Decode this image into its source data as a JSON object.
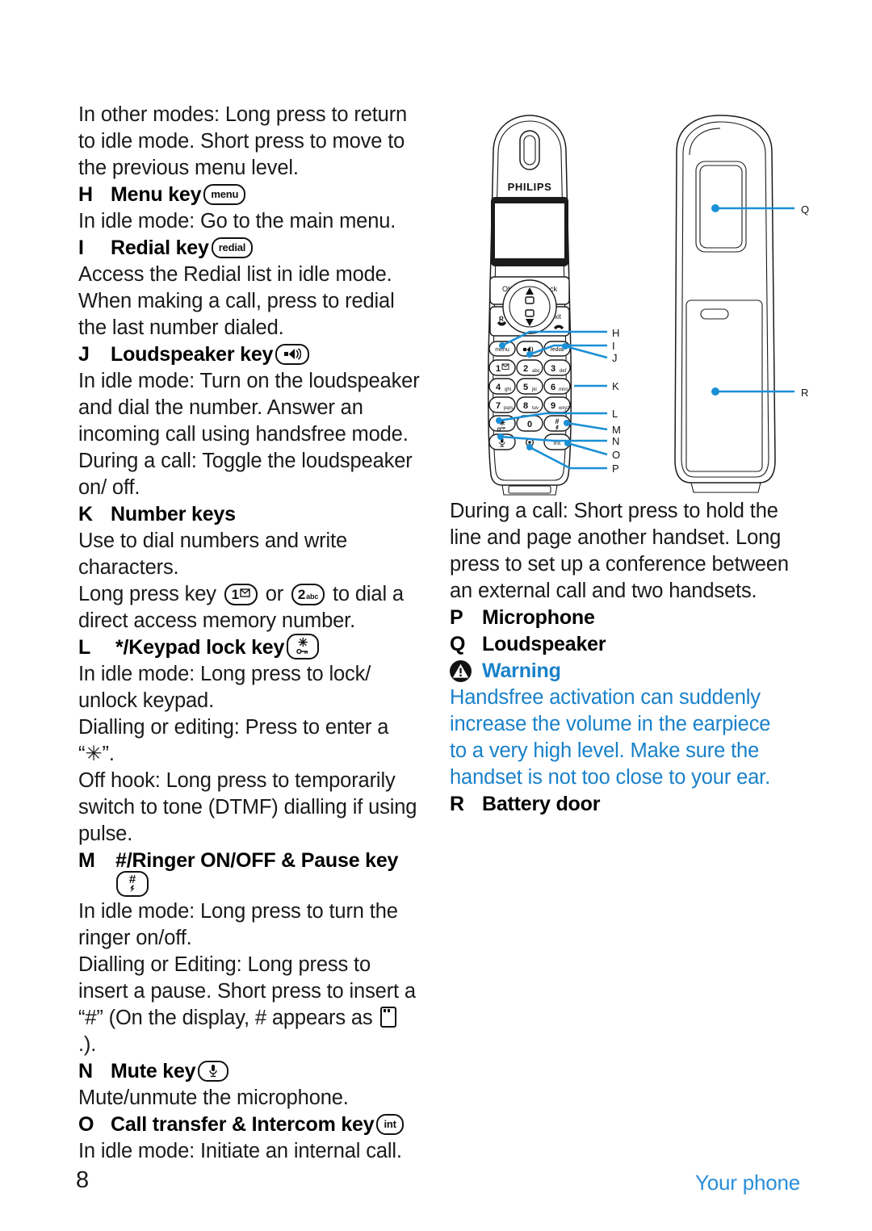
{
  "page": {
    "number": "8",
    "section": "Your phone",
    "accent_blue": "#1981c9",
    "footer_blue": "#2a8fd8"
  },
  "left_column": {
    "intro_paragraph": "In other modes: Long press to return to idle mode. Short press to move to the previous menu level.",
    "entries": [
      {
        "letter": "H",
        "title": "Menu key",
        "chip": {
          "type": "pill-text",
          "label": "menu",
          "icon_name": "menu-key-icon"
        },
        "body": [
          "In idle mode: Go to the main menu."
        ]
      },
      {
        "letter": "I",
        "title": "Redial key",
        "chip": {
          "type": "pill-text",
          "label": "redial",
          "icon_name": "redial-key-icon"
        },
        "body": [
          "Access the Redial list in idle mode.",
          "When making a call, press to redial the last number dialed."
        ]
      },
      {
        "letter": "J",
        "title": "Loudspeaker key",
        "chip": {
          "type": "pill-icon",
          "label": "",
          "icon_name": "loudspeaker-key-icon"
        },
        "body": [
          "In idle mode: Turn on the loudspeaker and dial the number. Answer an incoming call using handsfree mode.",
          "During a call: Toggle the loudspeaker on/ off."
        ]
      },
      {
        "letter": "K",
        "title": "Number keys",
        "chip": null,
        "body": [
          "Use to dial numbers and write characters."
        ],
        "inline_sentence": {
          "pre": "Long press key ",
          "key1": {
            "big": "1",
            "sub": "envelope",
            "icon_name": "key-1-voicemail-icon"
          },
          "mid": " or ",
          "key2": {
            "big": "2",
            "sub": "abc",
            "icon_name": "key-2-abc-icon"
          },
          "post": " to dial a direct access memory number."
        }
      },
      {
        "letter": "L",
        "title": "*/Keypad lock key",
        "chip": {
          "type": "pill-stack",
          "top": "✳",
          "bottom": "⚯",
          "icon_name": "star-keypad-lock-key-icon"
        },
        "body": [
          "In idle mode: Long press to lock/ unlock keypad.",
          "Dialling or editing: Press to enter a “✳”.",
          "Off hook: Long press to temporarily switch to tone (DTMF) dialling if using pulse."
        ]
      },
      {
        "letter": "M",
        "title": "#/Ringer ON/OFF & Pause key",
        "chip": {
          "type": "pill-stack-block",
          "top": "#",
          "bottom": "↯",
          "icon_name": "hash-ringer-pause-key-icon"
        },
        "body_pre": "In idle mode: Long press to turn the ringer on/off.",
        "body_split": {
          "pre": "Dialling or Editing: Long press to insert a pause. Short press to insert a “#” (On the display, # appears as ",
          "glyph_name": "hash-display-glyph-icon",
          "post": " .)."
        }
      },
      {
        "letter": "N",
        "title": "Mute key",
        "chip": {
          "type": "pill-icon",
          "label": "",
          "icon_name": "mute-microphone-key-icon"
        },
        "body": [
          "Mute/unmute the microphone."
        ]
      },
      {
        "letter": "O",
        "title": "Call transfer & Intercom key",
        "chip": {
          "type": "pill-text",
          "label": "int",
          "icon_name": "intercom-key-icon"
        },
        "body": [
          "In idle mode: Initiate an internal call."
        ]
      }
    ]
  },
  "right_column": {
    "lead_paragraph": "During a call: Short press to hold the line and page another handset. Long press to set up a conference between an external call and two handsets.",
    "entries": [
      {
        "letter": "P",
        "title": "Microphone"
      },
      {
        "letter": "Q",
        "title": "Loudspeaker"
      }
    ],
    "warning": {
      "icon_name": "warning-triangle-icon",
      "heading": "Warning",
      "text": "Handsfree activation can suddenly increase the volume in the earpiece to a very high level. Make sure the handset is not too close to your ear."
    },
    "entries_after": [
      {
        "letter": "R",
        "title": "Battery door"
      }
    ]
  },
  "diagram": {
    "brand": "PHILIPS",
    "soft_keys": {
      "left": "OK",
      "right": "back"
    },
    "nav_labels": {
      "up_icon": "phonebook-up-icon",
      "down_icon": "calllog-down-icon"
    },
    "call_keys": {
      "left": "R",
      "right": "exit"
    },
    "function_keys": [
      {
        "label": "menu",
        "name": "menu-key"
      },
      {
        "label": "",
        "name": "loudspeaker-key"
      },
      {
        "label": "redial",
        "name": "redial-key"
      }
    ],
    "keypad": [
      {
        "big": "1",
        "sub": "",
        "name": "key-1"
      },
      {
        "big": "2",
        "sub": "abc",
        "name": "key-2"
      },
      {
        "big": "3",
        "sub": "def",
        "name": "key-3"
      },
      {
        "big": "4",
        "sub": "ghi",
        "name": "key-4"
      },
      {
        "big": "5",
        "sub": "jkl",
        "name": "key-5"
      },
      {
        "big": "6",
        "sub": "mno",
        "name": "key-6"
      },
      {
        "big": "7",
        "sub": "pqrs",
        "name": "key-7"
      },
      {
        "big": "8",
        "sub": "tuv",
        "name": "key-8"
      },
      {
        "big": "9",
        "sub": "wxyz",
        "name": "key-9"
      },
      {
        "big": "✳",
        "sub": "",
        "name": "key-star"
      },
      {
        "big": "0",
        "sub": "",
        "name": "key-0"
      },
      {
        "big": "#",
        "sub": "",
        "name": "key-hash"
      }
    ],
    "bottom_keys": [
      {
        "label": "",
        "name": "mute-key"
      },
      {
        "label": "int",
        "name": "int-key"
      }
    ],
    "callouts_front": [
      "H",
      "I",
      "J",
      "K",
      "L",
      "M",
      "N",
      "O",
      "P"
    ],
    "callouts_side": [
      "Q",
      "R"
    ],
    "leader_color": "#1a8fd6"
  }
}
